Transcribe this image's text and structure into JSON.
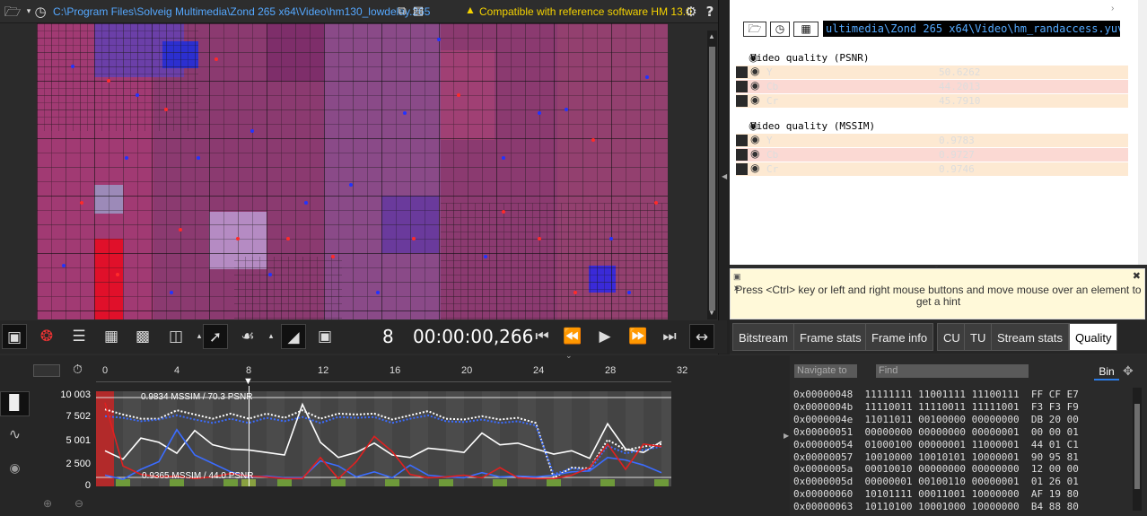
{
  "top_bar": {
    "file_path": "C:\\Program Files\\Solveig Multimedia\\Zond 265 x64\\Video\\hm130_lowdelay.265",
    "compat_text": "Compatible with reference software HM 13.0"
  },
  "toolbar": {
    "frame_number": "8",
    "timecode": "00:00:00,266"
  },
  "right_panel": {
    "ref_path": "ultimedia\\Zond 265 x64\\Video\\hm_randaccess.yuv",
    "psnr_title": "Video quality (PSNR)",
    "psnr": [
      {
        "name": "Y",
        "value": "50.6262",
        "bg": "#fde9d2"
      },
      {
        "name": "Cb",
        "value": "44.2013",
        "bg": "#fbd9d3"
      },
      {
        "name": "Cr",
        "value": "45.7910",
        "bg": "#fde9d2"
      }
    ],
    "mssim_title": "Video quality (MSSIM)",
    "mssim": [
      {
        "name": "Y",
        "value": "0.9783",
        "bg": "#fde9d2"
      },
      {
        "name": "Cb",
        "value": "0.9727",
        "bg": "#fbd9d3"
      },
      {
        "name": "Cr",
        "value": "0.9746",
        "bg": "#fde9d2"
      }
    ]
  },
  "hint": {
    "line1": "Press <Ctrl> key or left and right mouse buttons and move mouse over an element to",
    "line2": "get a hint"
  },
  "tabs": [
    "Bitstream",
    "Frame stats",
    "Frame info",
    "CU",
    "TU",
    "Stream stats",
    "Quality"
  ],
  "active_tab": "Quality",
  "timeline": {
    "ruler_labels": [
      "0",
      "4",
      "8",
      "12",
      "16",
      "20",
      "24",
      "28",
      "32"
    ],
    "current_frame": 8
  },
  "chart_data": {
    "type": "line",
    "yticks": [
      "10 003",
      "7 502",
      "5 001",
      "2 500",
      "0"
    ],
    "ylim": [
      0,
      10003
    ],
    "annotation_top": "0.9834 MSSIM / 70.3 PSNR",
    "annotation_bottom": "0.9365 MSSIM / 44.0 PSNR",
    "x": [
      0,
      1,
      2,
      3,
      4,
      5,
      6,
      7,
      8,
      9,
      10,
      11,
      12,
      13,
      14,
      15,
      16,
      17,
      18,
      19,
      20,
      21,
      22,
      23,
      24,
      25,
      26,
      27,
      28,
      29,
      30,
      31
    ],
    "series": [
      {
        "color": "#ffffff",
        "style": "solid",
        "values": [
          3800,
          2800,
          5300,
          4800,
          3500,
          6200,
          4500,
          4000,
          3900,
          3600,
          3300,
          9300,
          4800,
          3000,
          3600,
          4700,
          3300,
          3000,
          4100,
          3900,
          3600,
          5900,
          4500,
          4700,
          4000,
          3400,
          3800,
          2900,
          7000,
          4000,
          3600,
          4900
        ]
      },
      {
        "color": "#ffffff",
        "style": "dotted",
        "values": [
          8700,
          8100,
          7600,
          7600,
          8600,
          8100,
          7600,
          8200,
          7600,
          8200,
          7700,
          8600,
          7600,
          8200,
          8100,
          8200,
          7500,
          8000,
          8500,
          7600,
          7500,
          7900,
          7500,
          7700,
          7100,
          600,
          1800,
          1700,
          5100,
          3900,
          4300,
          4600
        ]
      },
      {
        "color": "#3b6cff",
        "style": "solid",
        "values": [
          900,
          400,
          1600,
          2500,
          6300,
          3300,
          2300,
          1300,
          700,
          800,
          600,
          600,
          2600,
          2000,
          700,
          1300,
          600,
          2100,
          900,
          700,
          600,
          1200,
          700,
          800,
          700,
          900,
          1300,
          1400,
          3000,
          2700,
          2100,
          1200
        ]
      },
      {
        "color": "#3b6cff",
        "style": "dotted",
        "values": [
          7900,
          7700,
          7300,
          7500,
          8000,
          7500,
          7100,
          7600,
          7100,
          7700,
          7300,
          7800,
          7100,
          7800,
          7700,
          7800,
          7100,
          7600,
          8000,
          7300,
          7200,
          7500,
          7100,
          7300,
          6800,
          1000,
          1700,
          1500,
          4400,
          3500,
          3900,
          4300
        ]
      },
      {
        "color": "#e02020",
        "style": "solid",
        "values": [
          9500,
          2000,
          1000,
          700,
          800,
          500,
          700,
          1100,
          800,
          700,
          500,
          500,
          3000,
          500,
          2500,
          5500,
          3700,
          1000,
          600,
          700,
          900,
          600,
          1800,
          600,
          500,
          500,
          900,
          1800,
          4600,
          1600,
          4600,
          4300
        ]
      }
    ],
    "bars": [
      0,
      0,
      0,
      0,
      0,
      0,
      0,
      0,
      400,
      0,
      0,
      0,
      0,
      0,
      0,
      0,
      0,
      0,
      0,
      0,
      0,
      0,
      0,
      0,
      0,
      0,
      0,
      0,
      0,
      0,
      0,
      0
    ]
  },
  "hex_panel": {
    "nav_placeholder": "Navigate to",
    "find_placeholder": "Find",
    "mode": "Bin",
    "rows": [
      "0x00000048  11111111 11001111 11100111  FF CF E7",
      "0x0000004b  11110011 11110011 11111001  F3 F3 F9",
      "0x0000004e  11011011 00100000 00000000  DB 20 00",
      "0x00000051  00000000 00000000 00000001  00 00 01",
      "0x00000054  01000100 00000001 11000001  44 01 C1",
      "0x00000057  10010000 10010101 10000001  90 95 81",
      "0x0000005a  00010010 00000000 00000000  12 00 00",
      "0x0000005d  00000001 00100110 00000001  01 26 01",
      "0x00000060  10101111 00011001 10000000  AF 19 80",
      "0x00000063  10110100 10001000 10000000  B4 88 80"
    ]
  }
}
